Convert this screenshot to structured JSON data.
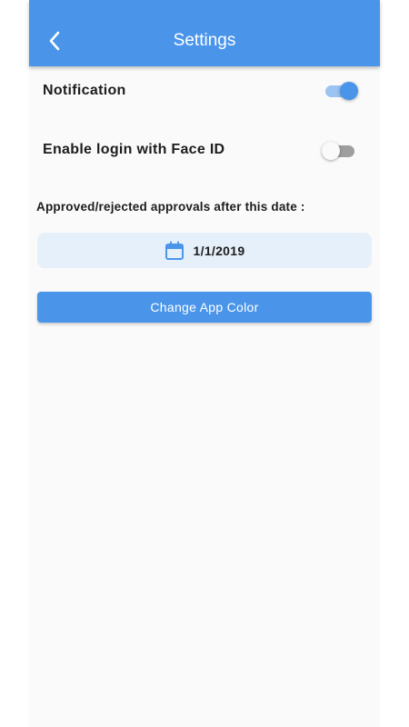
{
  "appbar": {
    "title": "Settings",
    "back_icon": "chevron-left-icon"
  },
  "settings": {
    "notification": {
      "label": "Notification",
      "enabled": true
    },
    "face_id": {
      "label": "Enable login with Face ID",
      "enabled": false
    }
  },
  "approvals": {
    "label": "Approved/rejected approvals after this date :",
    "date": "1/1/2019",
    "icon": "calendar-icon"
  },
  "actions": {
    "change_color_label": "Change App Color"
  },
  "colors": {
    "primary": "#4a95ea",
    "date_box_bg": "#e6f0fa",
    "background": "#fafafa"
  }
}
